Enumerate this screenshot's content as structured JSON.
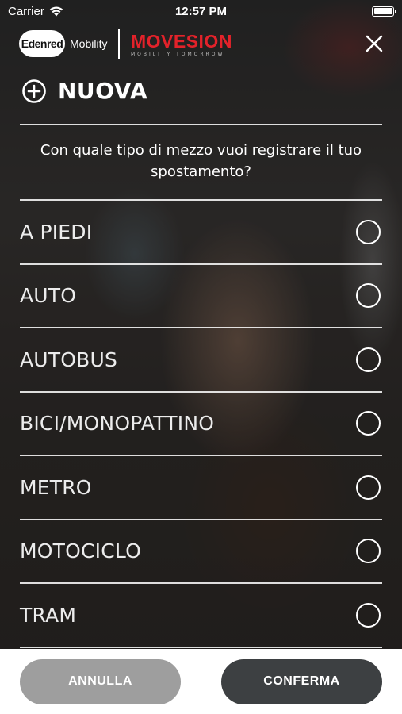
{
  "status_bar": {
    "carrier": "Carrier",
    "time": "12:57 PM",
    "wifi_icon": "wifi-icon",
    "battery_icon": "battery-icon"
  },
  "header": {
    "edenred_logo": "Edenred",
    "mobility_label": "Mobility",
    "movesion_logo": "MOVESION",
    "movesion_tagline": "MOBILITY TOMORROW",
    "close_icon": "close-icon"
  },
  "title": {
    "icon": "plus-circle-icon",
    "text": "NUOVA"
  },
  "question": "Con quale tipo di mezzo vuoi registrare il tuo spostamento?",
  "options": [
    {
      "label": "A PIEDI",
      "selected": false
    },
    {
      "label": "AUTO",
      "selected": false
    },
    {
      "label": "AUTOBUS",
      "selected": false
    },
    {
      "label": "BICI/MONOPATTINO",
      "selected": false
    },
    {
      "label": "METRO",
      "selected": false
    },
    {
      "label": "MOTOCICLO",
      "selected": false
    },
    {
      "label": "TRAM",
      "selected": false
    }
  ],
  "footer": {
    "cancel_label": "ANNULLA",
    "confirm_label": "CONFERMA"
  },
  "colors": {
    "brand_red": "#e3222a",
    "cancel_button": "#9e9e9e",
    "confirm_button": "#3d4042"
  }
}
